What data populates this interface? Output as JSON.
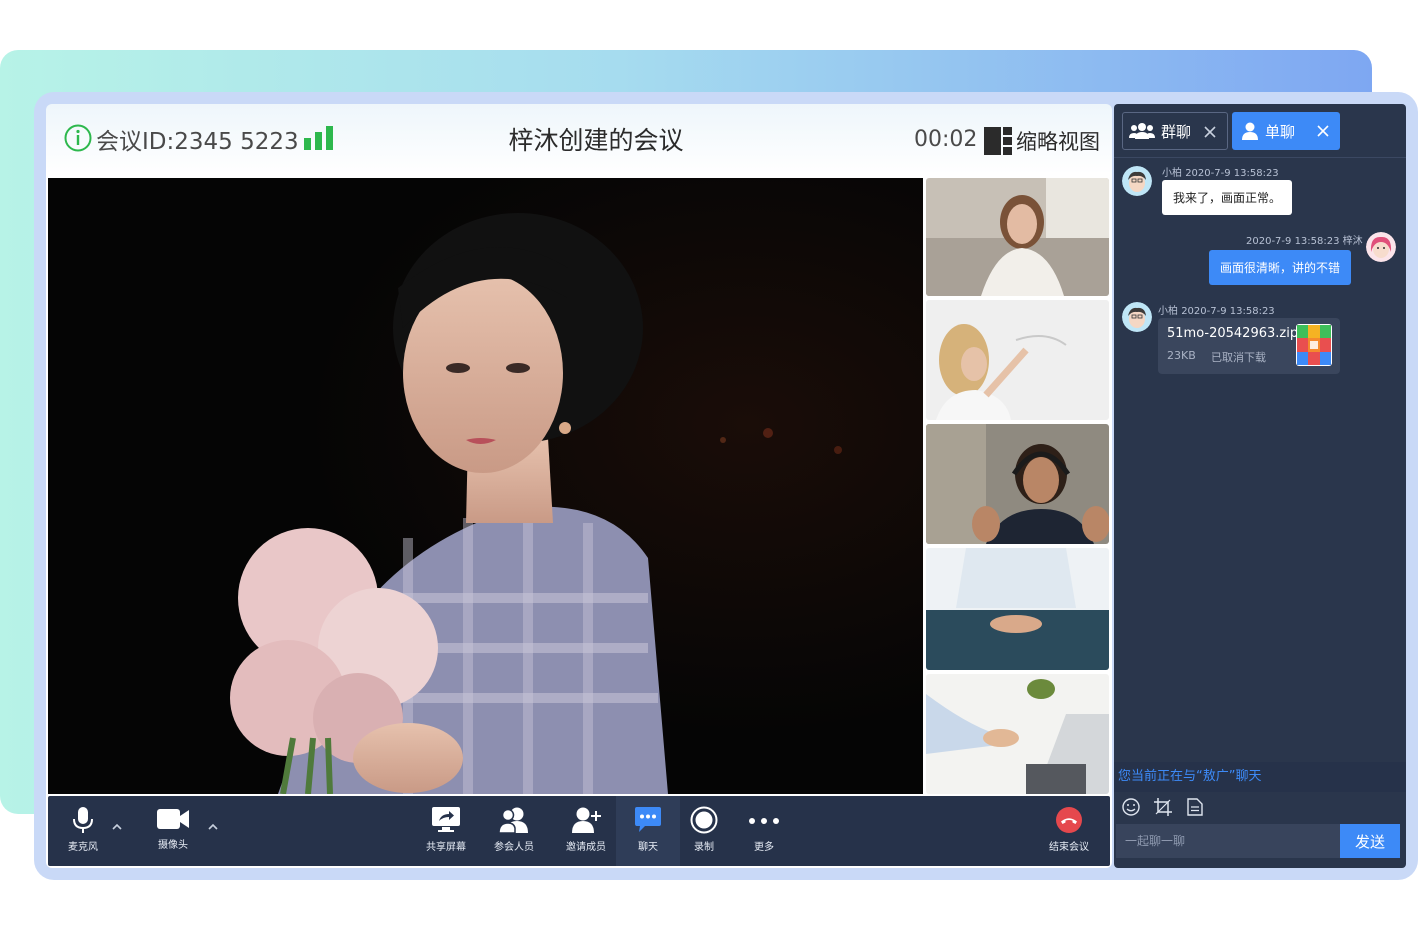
{
  "header": {
    "meeting_id": "会议ID:2345 5223",
    "title": "梓沐创建的会议",
    "timer": "00:02",
    "thumb_view_label": "缩略视图"
  },
  "toolbar": {
    "mic_label": "麦克风",
    "camera_label": "摄像头",
    "share_label": "共享屏幕",
    "participants_label": "参会人员",
    "invite_label": "邀请成员",
    "chat_label": "聊天",
    "record_label": "录制",
    "more_label": "更多",
    "end_label": "结束会议"
  },
  "chat": {
    "tabs": [
      {
        "label": "群聊",
        "icon": "group-icon",
        "active": false
      },
      {
        "label": "单聊",
        "icon": "user-icon",
        "active": true
      }
    ],
    "messages": [
      {
        "sender": "小柏",
        "time": "2020-7-9 13:58:23",
        "text": "我来了，画面正常。",
        "direction": "incoming"
      },
      {
        "sender": "梓沐",
        "time": "2020-7-9 13:58:23",
        "text": "画面很清晰，讲的不错",
        "direction": "outgoing"
      },
      {
        "sender": "小柏",
        "time": "2020-7-9 13:58:23",
        "file_name": "51mo-20542963.zip",
        "file_size": "23KB",
        "file_status": "已取消下载",
        "direction": "incoming"
      }
    ],
    "hint": "您当前正在与“敖广”聊天",
    "input_placeholder": "一起聊一聊",
    "send_label": "发送"
  },
  "colors": {
    "accent": "#3d8af7",
    "toolbar_bg": "#26324a",
    "chat_bg": "#2a364c",
    "end_call": "#e5484d",
    "signal": "#2db84d"
  }
}
